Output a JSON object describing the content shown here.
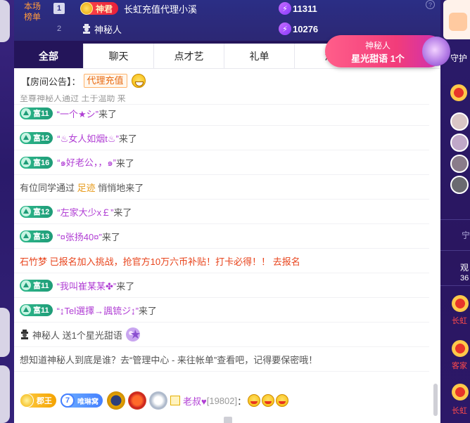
{
  "rank": {
    "label_line1": "本场",
    "label_line2": "榜单",
    "help": "?",
    "rows": [
      {
        "num": "1",
        "badge": "神君",
        "name": "长虹充值代理小溪",
        "score": "11311"
      },
      {
        "num": "2",
        "name": "神秘人",
        "score": "10276"
      }
    ]
  },
  "tabs": [
    "全部",
    "聊天",
    "点才艺",
    "礼单",
    "活"
  ],
  "announcement": {
    "label": "【房间公告】：",
    "link": "代理充值"
  },
  "cut_line": "至尊神秘人通过 土于温助 来",
  "messages": [
    {
      "type": "enter",
      "level": "富11",
      "name": "“一个★シ”",
      "suffix": "来了"
    },
    {
      "type": "enter",
      "level": "富12",
      "name": "“♨女人如烟t♨”",
      "suffix": "来了"
    },
    {
      "type": "enter",
      "level": "富16",
      "name": "“๑好老公，，๑”",
      "suffix": "来了"
    },
    {
      "type": "via",
      "prefix": "有位同学通过",
      "via": "足迹",
      "suffix": "悄悄地来了"
    },
    {
      "type": "enter",
      "level": "富12",
      "name": "“左家大少x￡”",
      "suffix": "来了"
    },
    {
      "type": "enter",
      "level": "富13",
      "name": "“¤张扬40¤”",
      "suffix": "来了"
    },
    {
      "type": "promo",
      "text": "石竹梦 已报名加入挑战，抢官方10万六币补贴！打卡必得！！",
      "link": "去报名"
    },
    {
      "type": "enter",
      "level": "富11",
      "name": "“我叫崔某某✤”",
      "suffix": "来了"
    },
    {
      "type": "enter",
      "level": "富11",
      "name": "“↨Tel選擇→諷锍ジ↨”",
      "suffix": "来了"
    },
    {
      "type": "gift",
      "name": "神秘人",
      "text": "送1个星光甜语"
    },
    {
      "type": "system",
      "text": "想知道神秘人到底是谁？去“管理中心 - 来往帐单”查看吧，记得要保密哦！"
    }
  ],
  "bottom": {
    "jun": "郡王",
    "fan_num": "7",
    "fan_name": "唯琳窝",
    "user": "老叔♥",
    "uid": "[19802]",
    "colon": "："
  },
  "gift_pop": {
    "name": "神秘人",
    "gift": "星光甜语 1个"
  },
  "right_col": {
    "guard": "守护",
    "watch_label": "观",
    "watch_count": "36",
    "sym": "宁",
    "r1": "长虹",
    "r2": "客家",
    "r3": "长虹"
  },
  "colors": {
    "theme_dark": "#24155a",
    "rank_bg": "#2b2e85",
    "wealth_green": "#1f9c78",
    "name_purple": "#b03ed4",
    "promo_red": "#e8441c",
    "gold": "#e79a1a"
  }
}
